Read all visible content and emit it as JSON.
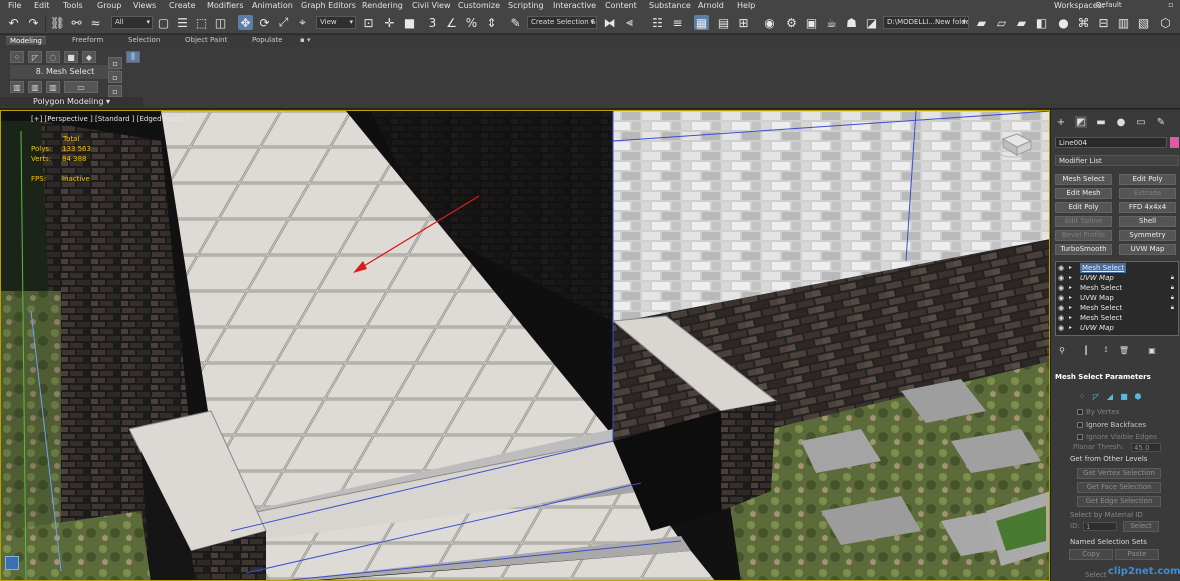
{
  "menu": {
    "items": [
      "File",
      "Edit",
      "Tools",
      "Group",
      "Views",
      "Create",
      "Modifiers",
      "Animation",
      "Graph Editors",
      "Rendering",
      "Civil View",
      "Customize",
      "Scripting",
      "Interactive",
      "Content",
      "Substance",
      "Arnold",
      "Help"
    ],
    "workspaces_label": "Workspaces:",
    "workspace_value": "Default"
  },
  "toolbar": {
    "filter_value": "All",
    "ref_coord_value": "View",
    "selection_set_placeholder": "Create Selection Se",
    "path_value": "D:\\MODELLI...New folder"
  },
  "ribbon": {
    "tabs": [
      "Modeling",
      "Freeform",
      "Selection",
      "Object Paint",
      "Populate"
    ],
    "mesh_select_label": "8. Mesh Select",
    "polygon_modeling_label": "Polygon Modeling ▾"
  },
  "viewport": {
    "label": "[+] [Perspective ] [Standard ] [Edged Faces ]",
    "stats": {
      "total_label": "Total",
      "polys_label": "Polys:",
      "polys_value": "133 563",
      "verts_label": "Verts:",
      "verts_value": "84 388",
      "fps_label": "FPS:",
      "fps_value": "Inactive"
    }
  },
  "command_panel": {
    "object_name": "Line004",
    "object_color": "#e05aa8",
    "modifier_list_label": "Modifier List",
    "modifier_buttons": [
      {
        "label": "Mesh Select",
        "enabled": true
      },
      {
        "label": "Edit Poly",
        "enabled": true
      },
      {
        "label": "Edit Mesh",
        "enabled": true
      },
      {
        "label": "Extrude",
        "enabled": false
      },
      {
        "label": "Edit Poly",
        "enabled": true
      },
      {
        "label": "FFD 4x4x4",
        "enabled": true
      },
      {
        "label": "Edit Spline",
        "enabled": false
      },
      {
        "label": "Shell",
        "enabled": true
      },
      {
        "label": "Bevel Profile",
        "enabled": false
      },
      {
        "label": "Symmetry",
        "enabled": true
      },
      {
        "label": "TurboSmooth",
        "enabled": true
      },
      {
        "label": "UVW Map",
        "enabled": true
      }
    ],
    "stack": [
      {
        "name": "Mesh Select",
        "selected": true,
        "italic": false
      },
      {
        "name": "UVW Map",
        "selected": false,
        "italic": true
      },
      {
        "name": "Mesh Select",
        "selected": false,
        "italic": false
      },
      {
        "name": "UVW Map",
        "selected": false,
        "italic": false
      },
      {
        "name": "Mesh Select",
        "selected": false,
        "italic": false
      },
      {
        "name": "Mesh Select",
        "selected": false,
        "italic": false
      },
      {
        "name": "UVW Map",
        "selected": false,
        "italic": true
      }
    ],
    "rollout_title": "Mesh Select Parameters",
    "by_vertex_label": "By Vertex",
    "ignore_backfaces_label": "Ignore Backfaces",
    "ignore_visible_edges_label": "Ignore Visible Edges",
    "planar_thresh_label": "Planar Thresh:",
    "planar_thresh_value": "45.0",
    "get_from_levels_title": "Get from Other Levels",
    "get_vertex_btn": "Get Vertex Selection",
    "get_face_btn": "Get Face Selection",
    "get_edge_btn": "Get Edge Selection",
    "select_by_matid_title": "Select by Material ID",
    "id_label": "ID:",
    "id_value": "1",
    "select_btn": "Select",
    "named_sets_title": "Named Selection Sets",
    "copy_btn": "Copy",
    "paste_btn": "Paste",
    "select_bottom": "Select"
  },
  "watermark": "clip2net.com"
}
